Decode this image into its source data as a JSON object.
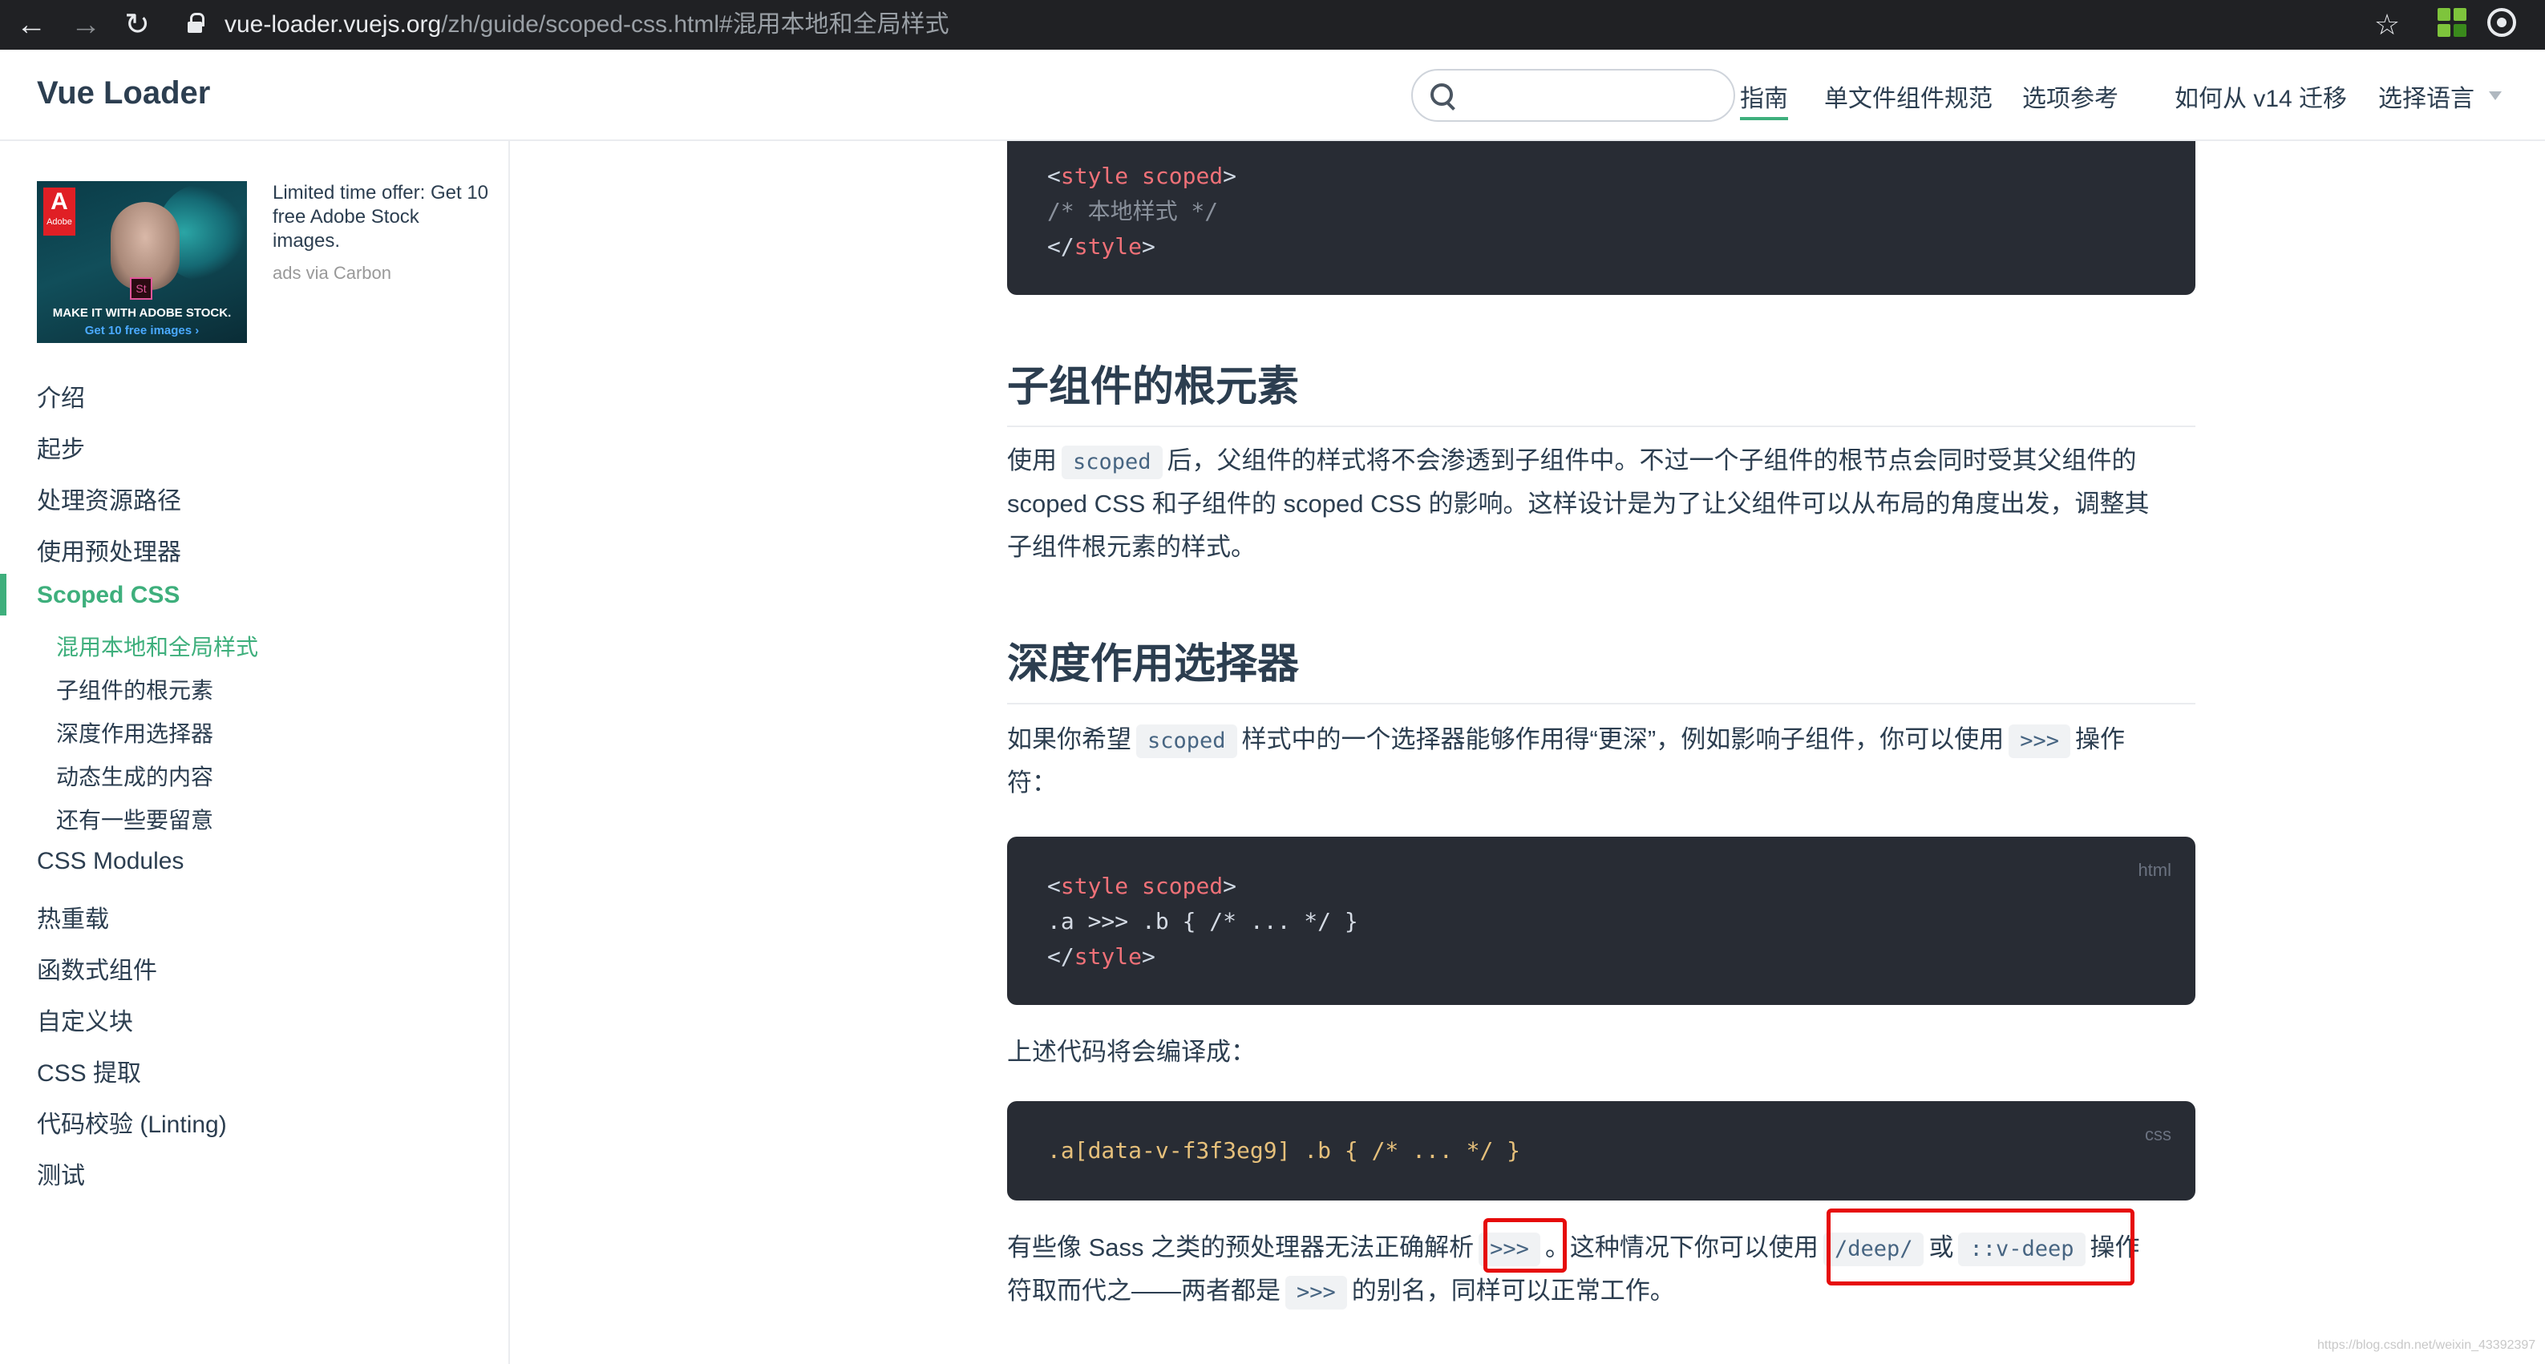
{
  "browser": {
    "url_host": "vue-loader.vuejs.org",
    "url_path": "/zh/guide/scoped-css.html#混用本地和全局样式"
  },
  "header": {
    "logo": "Vue Loader",
    "search_placeholder": "",
    "nav": [
      "指南",
      "单文件组件规范",
      "选项参考",
      "如何从 v14 迁移",
      "选择语言"
    ],
    "active_nav": "指南"
  },
  "ad": {
    "text": "Limited time offer: Get 10 free Adobe Stock images.",
    "via": "ads via Carbon",
    "image_logo": "Adobe",
    "image_caption": "MAKE IT WITH ADOBE STOCK.",
    "image_link": "Get 10 free images ›",
    "image_badge": "St"
  },
  "sidebar": {
    "items": [
      "介绍",
      "起步",
      "处理资源路径",
      "使用预处理器",
      "Scoped CSS",
      "CSS Modules",
      "热重载",
      "函数式组件",
      "自定义块",
      "CSS 提取",
      "代码校验 (Linting)",
      "测试"
    ],
    "active_item": "Scoped CSS",
    "sub_items": [
      "混用本地和全局样式",
      "子组件的根元素",
      "深度作用选择器",
      "动态生成的内容",
      "还有一些要留意"
    ],
    "active_sub_item": "混用本地和全局样式"
  },
  "content": {
    "code1": {
      "lines": [
        "<style scoped>",
        "/* 本地样式 */",
        "</style>"
      ]
    },
    "h2_root": "子组件的根元素",
    "p1": {
      "l1_a": "使用",
      "l1_code": "scoped",
      "l1_b": "后，父组件的样式将不会渗透到子组件中。不过一个子组件的根节点会同时受其父组件的",
      "l2": "scoped CSS 和子组件的 scoped CSS 的影响。这样设计是为了让父组件可以从布局的角度出发，调整其",
      "l3": "子组件根元素的样式。"
    },
    "h2_deep": "深度作用选择器",
    "p2": {
      "l1_a": "如果你希望",
      "l1_code1": "scoped",
      "l1_b": "样式中的一个选择器能够作用得“更深”，例如影响子组件，你可以使用",
      "l1_code2": ">>>",
      "l1_c": "操作",
      "l2": "符："
    },
    "code2": {
      "lang": "html",
      "lines": [
        "<style scoped>",
        ".a >>> .b { /* ... */ }",
        "</style>"
      ]
    },
    "p3": "上述代码将会编译成：",
    "code3": {
      "lang": "css",
      "lines": [
        ".a[data-v-f3f3eg9] .b { /* ... */ }"
      ]
    },
    "p4": {
      "l1_a": "有些像 Sass 之类的预处理器无法正确解析",
      "l1_code1": ">>>",
      "l1_b": "。这种情况下你可以使用",
      "l1_code2": "/deep/",
      "l1_c": "或",
      "l1_code3": "::v-deep",
      "l1_d": "操作",
      "l2_a": "符取而代之——两者都是",
      "l2_code": ">>>",
      "l2_b": "的别名，同样可以正常工作。"
    },
    "watermark": "https://blog.csdn.net/weixin_43392397"
  }
}
